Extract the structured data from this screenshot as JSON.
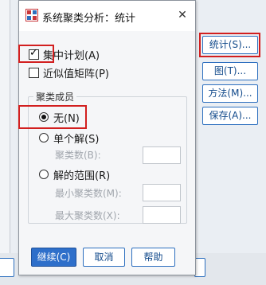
{
  "dialog": {
    "title": "系统聚类分析：统计",
    "close_glyph": "✕"
  },
  "options": {
    "agglomeration_schedule": {
      "label": "集中计划(A)",
      "checked": true
    },
    "proximity_matrix": {
      "label": "近似值矩阵(P)",
      "checked": false
    }
  },
  "cluster_membership": {
    "title": "聚类成员",
    "none": {
      "label": "无(N)",
      "selected": true
    },
    "single_solution": {
      "label": "单个解(S)",
      "selected": false
    },
    "num_clusters_label": "聚类数(B):",
    "range_of_solutions": {
      "label": "解的范围(R)",
      "selected": false
    },
    "min_clusters_label": "最小聚类数(M):",
    "max_clusters_label": "最大聚类数(X):"
  },
  "footer": {
    "continue_label": "继续(C)",
    "cancel_label": "取消",
    "help_label": "帮助"
  },
  "side_buttons": {
    "statistics_label": "统计(S)...",
    "plots_label": "图(T)...",
    "method_label": "方法(M)...",
    "save_label": "保存(A)..."
  },
  "colors": {
    "highlight": "#d21f1f",
    "primary_button": "#2e6fca",
    "button_border": "#2d6fbf"
  }
}
